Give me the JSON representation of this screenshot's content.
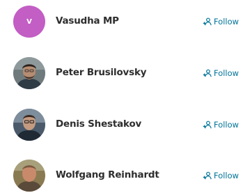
{
  "people": [
    {
      "name": "Vasudha MP",
      "avatar_initial": "V",
      "avatar_color": "#c25ec4",
      "follow_label": "Follow"
    },
    {
      "name": "Peter Brusilovsky",
      "avatar_icon": "person-photo",
      "follow_label": "Follow"
    },
    {
      "name": "Denis Shestakov",
      "avatar_icon": "person-photo",
      "follow_label": "Follow"
    },
    {
      "name": "Wolfgang Reinhardt",
      "avatar_icon": "person-photo",
      "follow_label": "Follow"
    }
  ],
  "colors": {
    "follow_link": "#007398",
    "name_text": "#2e2e2e"
  },
  "icons": {
    "follow": "person-plus-icon"
  }
}
